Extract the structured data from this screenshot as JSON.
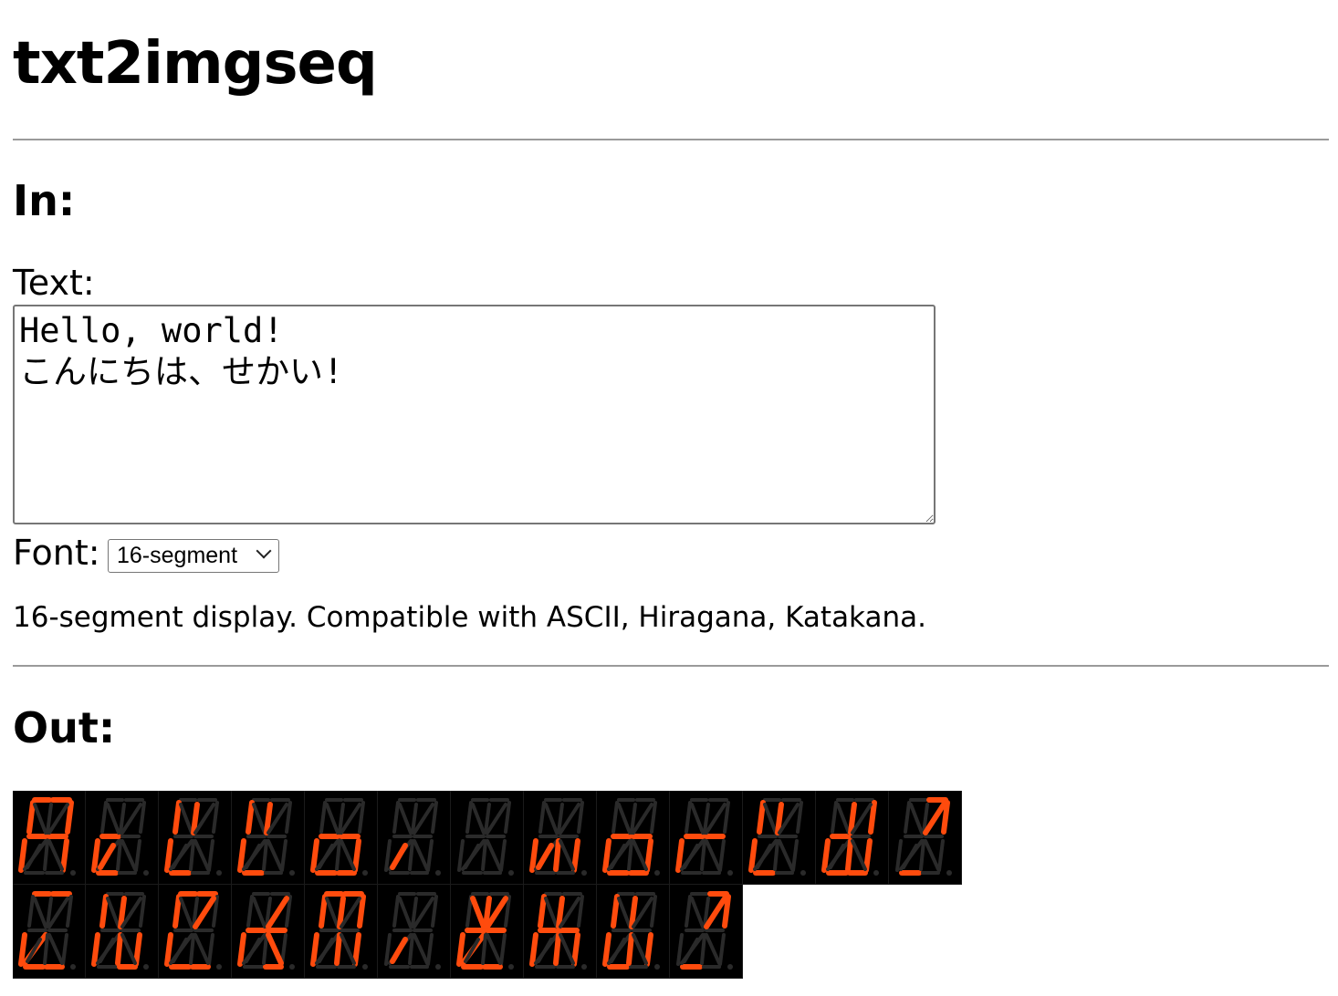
{
  "app": {
    "title": "txt2imgseq"
  },
  "input": {
    "heading": "In:",
    "text_label": "Text:",
    "text_value": "Hello, world!\nこんにちは、せかい!",
    "font_label": "Font:",
    "font_selected": "16-segment",
    "font_description": "16-segment display. Compatible with ASCII, Hiragana, Katakana."
  },
  "output": {
    "heading": "Out:",
    "lit_color": "#ff4b0d",
    "unlit_color": "#2a2a2a",
    "background": "#000000",
    "rows": [
      {
        "chars": [
          "H",
          "e",
          "l",
          "l",
          "o",
          ",",
          "",
          "w",
          "o",
          "r",
          "l",
          "d",
          "!"
        ],
        "cells": [
          [
            "a1",
            "a2",
            "f",
            "b",
            "g1",
            "g2",
            "e",
            "c"
          ],
          [
            "d1",
            "e",
            "g1",
            "n"
          ],
          [
            "f",
            "i",
            "e",
            "d1"
          ],
          [
            "f",
            "i",
            "e",
            "d1"
          ],
          [
            "e",
            "g1",
            "c",
            "d1",
            "d2",
            "g2"
          ],
          [
            "n"
          ],
          [],
          [
            "e",
            "l",
            "n",
            "c"
          ],
          [
            "e",
            "g1",
            "g2",
            "c",
            "d1",
            "d2"
          ],
          [
            "e",
            "g1",
            "g2"
          ],
          [
            "f",
            "i",
            "e",
            "d1"
          ],
          [
            "e",
            "g1",
            "d1",
            "d2",
            "c",
            "b",
            "i",
            "l"
          ],
          [
            "b",
            "a2",
            "j",
            "d1"
          ]
        ]
      },
      {
        "chars": [
          "こ",
          "ん",
          "に",
          "ち",
          "は",
          "、",
          "せ",
          "か",
          "い",
          "!"
        ],
        "cells": [
          [
            "a1",
            "a2",
            "k",
            "e",
            "d1",
            "d2"
          ],
          [
            "f",
            "e",
            "i",
            "l",
            "c",
            "d2"
          ],
          [
            "a1",
            "a2",
            "j",
            "f",
            "e",
            "d1",
            "d2"
          ],
          [
            "g1",
            "g2",
            "j",
            "m",
            "e",
            "d2"
          ],
          [
            "a1",
            "a2",
            "f",
            "e",
            "i",
            "l",
            "c",
            "b"
          ],
          [
            "n"
          ],
          [
            "g1",
            "g2",
            "h",
            "i",
            "j",
            "k",
            "e",
            "d1",
            "d2"
          ],
          [
            "f",
            "e",
            "g1",
            "g2",
            "l",
            "c",
            "i"
          ],
          [
            "f",
            "e",
            "d1",
            "i",
            "l",
            "c"
          ],
          [
            "b",
            "a2",
            "j",
            "d1"
          ]
        ]
      }
    ]
  }
}
